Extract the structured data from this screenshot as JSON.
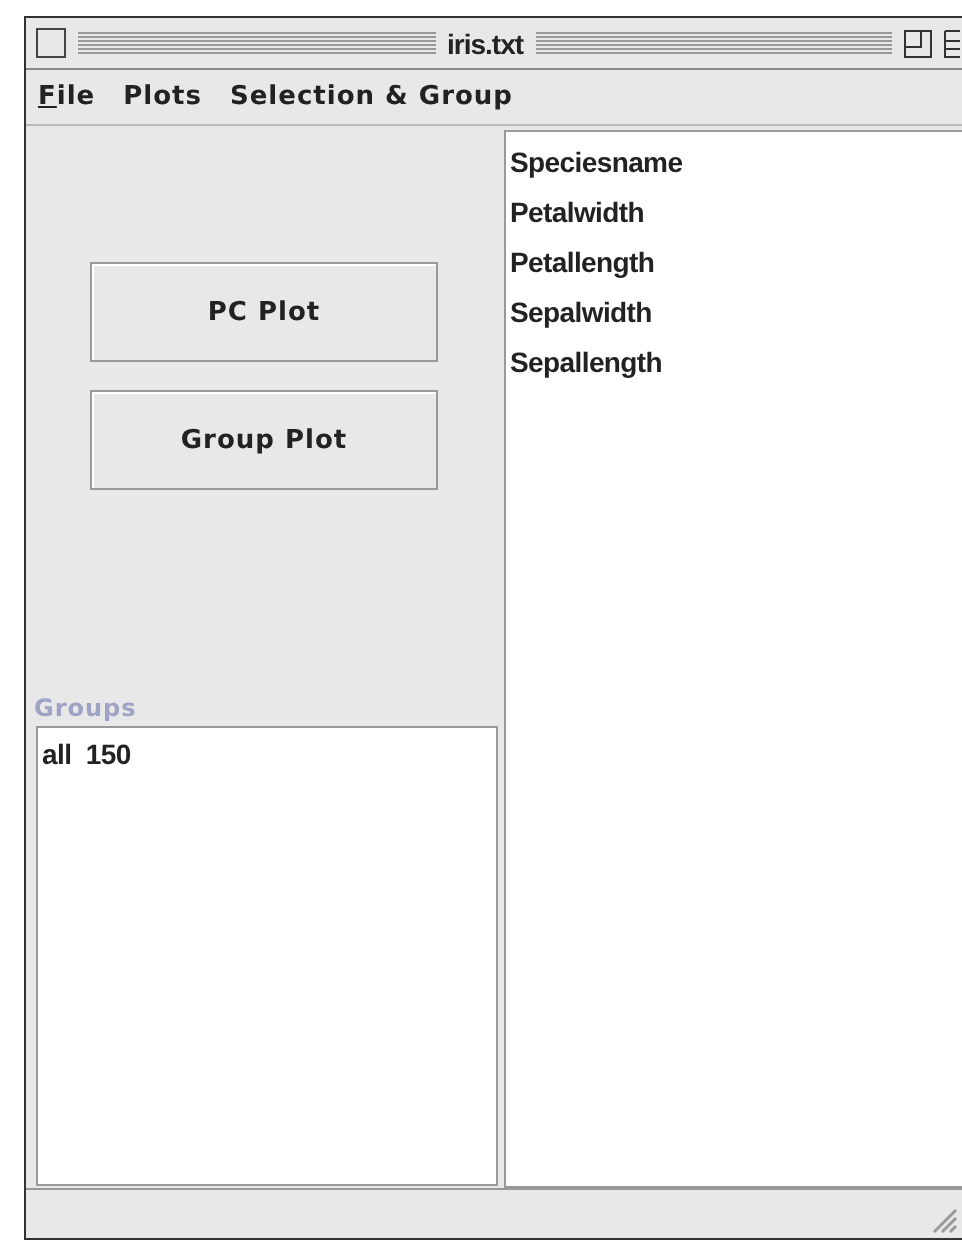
{
  "window": {
    "title": "iris.txt"
  },
  "menu": [
    {
      "label": "File",
      "mnemonic": true
    },
    {
      "label": "Plots"
    },
    {
      "label": "Selection & Group"
    }
  ],
  "buttons": [
    "PC Plot",
    "Group Plot"
  ],
  "groups": {
    "label": "Groups",
    "items": [
      "all  150"
    ]
  },
  "variables": [
    "Speciesname",
    "Petalwidth",
    "Petallength",
    "Sepalwidth",
    "Sepallength"
  ]
}
